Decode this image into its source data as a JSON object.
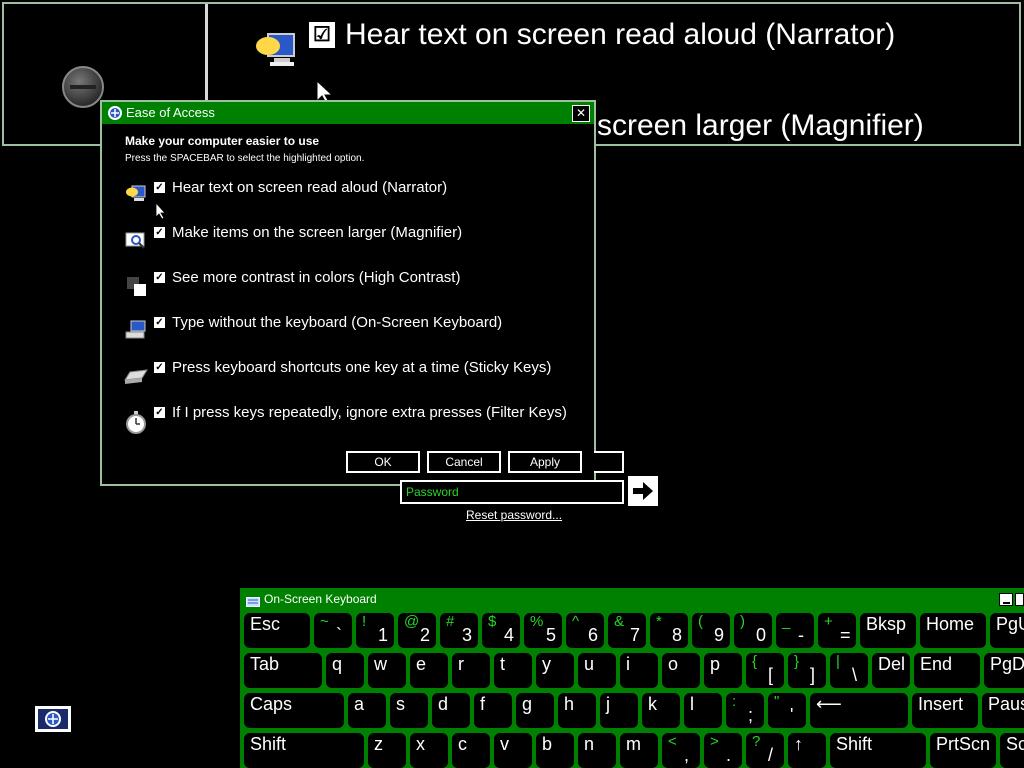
{
  "magnifier": {
    "line1": "Hear text on screen read aloud (Narrator)",
    "line2": "screen larger (Magnifier)"
  },
  "dialog": {
    "title": "Ease of Access",
    "close": "✕",
    "heading": "Make your computer easier to use",
    "subheading": "Press the SPACEBAR to select the highlighted option.",
    "options": [
      {
        "label": "Hear text on screen read aloud (Narrator)",
        "checked": true,
        "icon": "narrator-icon"
      },
      {
        "label": "Make items on the screen larger (Magnifier)",
        "checked": true,
        "icon": "magnifier-icon"
      },
      {
        "label": "See more contrast in colors (High Contrast)",
        "checked": true,
        "icon": "high-contrast-icon"
      },
      {
        "label": "Type without the keyboard (On-Screen Keyboard)",
        "checked": true,
        "icon": "keyboard-icon"
      },
      {
        "label": "Press keyboard shortcuts one key at a time (Sticky Keys)",
        "checked": true,
        "icon": "sticky-keys-icon"
      },
      {
        "label": "If I press keys repeatedly, ignore extra presses (Filter Keys)",
        "checked": true,
        "icon": "filter-keys-icon"
      }
    ],
    "buttons": {
      "ok": "OK",
      "cancel": "Cancel",
      "apply": "Apply"
    }
  },
  "logon": {
    "password_placeholder": "Password",
    "reset_link": "Reset password..."
  },
  "osk": {
    "title": "On-Screen Keyboard",
    "row1": [
      {
        "l": "Esc"
      },
      {
        "s": "~",
        "b": "`"
      },
      {
        "s": "!",
        "b": "1"
      },
      {
        "s": "@",
        "b": "2"
      },
      {
        "s": "#",
        "b": "3"
      },
      {
        "s": "$",
        "b": "4"
      },
      {
        "s": "%",
        "b": "5"
      },
      {
        "s": "^",
        "b": "6"
      },
      {
        "s": "&",
        "b": "7"
      },
      {
        "s": "*",
        "b": "8"
      },
      {
        "s": "(",
        "b": "9"
      },
      {
        "s": ")",
        "b": "0"
      },
      {
        "s": "_",
        "b": "-"
      },
      {
        "s": "+",
        "b": "="
      },
      {
        "l": "Bksp"
      },
      {
        "l": "Home"
      },
      {
        "l": "PgUp"
      }
    ],
    "row2": [
      {
        "l": "Tab"
      },
      {
        "l": "q"
      },
      {
        "l": "w"
      },
      {
        "l": "e"
      },
      {
        "l": "r"
      },
      {
        "l": "t"
      },
      {
        "l": "y"
      },
      {
        "l": "u"
      },
      {
        "l": "i"
      },
      {
        "l": "o"
      },
      {
        "l": "p"
      },
      {
        "s": "{",
        "b": "["
      },
      {
        "s": "}",
        "b": "]"
      },
      {
        "s": "|",
        "b": "\\"
      },
      {
        "l": "Del"
      },
      {
        "l": "End"
      },
      {
        "l": "PgDn"
      }
    ],
    "row3": [
      {
        "l": "Caps"
      },
      {
        "l": "a"
      },
      {
        "l": "s"
      },
      {
        "l": "d"
      },
      {
        "l": "f"
      },
      {
        "l": "g"
      },
      {
        "l": "h"
      },
      {
        "l": "j"
      },
      {
        "l": "k"
      },
      {
        "l": "l"
      },
      {
        "s": ":",
        "b": ";"
      },
      {
        "s": "\"",
        "b": "'"
      },
      {
        "l": "⟵"
      },
      {
        "l": "Insert"
      },
      {
        "l": "Pause"
      }
    ],
    "row4": [
      {
        "l": "Shift"
      },
      {
        "l": "z"
      },
      {
        "l": "x"
      },
      {
        "l": "c"
      },
      {
        "l": "v"
      },
      {
        "l": "b"
      },
      {
        "l": "n"
      },
      {
        "l": "m"
      },
      {
        "s": "<",
        "b": ","
      },
      {
        "s": ">",
        "b": "."
      },
      {
        "s": "?",
        "b": "/"
      },
      {
        "l": "↑"
      },
      {
        "l": "Shift"
      },
      {
        "l": "PrtScn"
      },
      {
        "l": "ScrLk"
      }
    ]
  },
  "colors": {
    "accent_green": "#008000",
    "shift_green": "#27d627"
  }
}
